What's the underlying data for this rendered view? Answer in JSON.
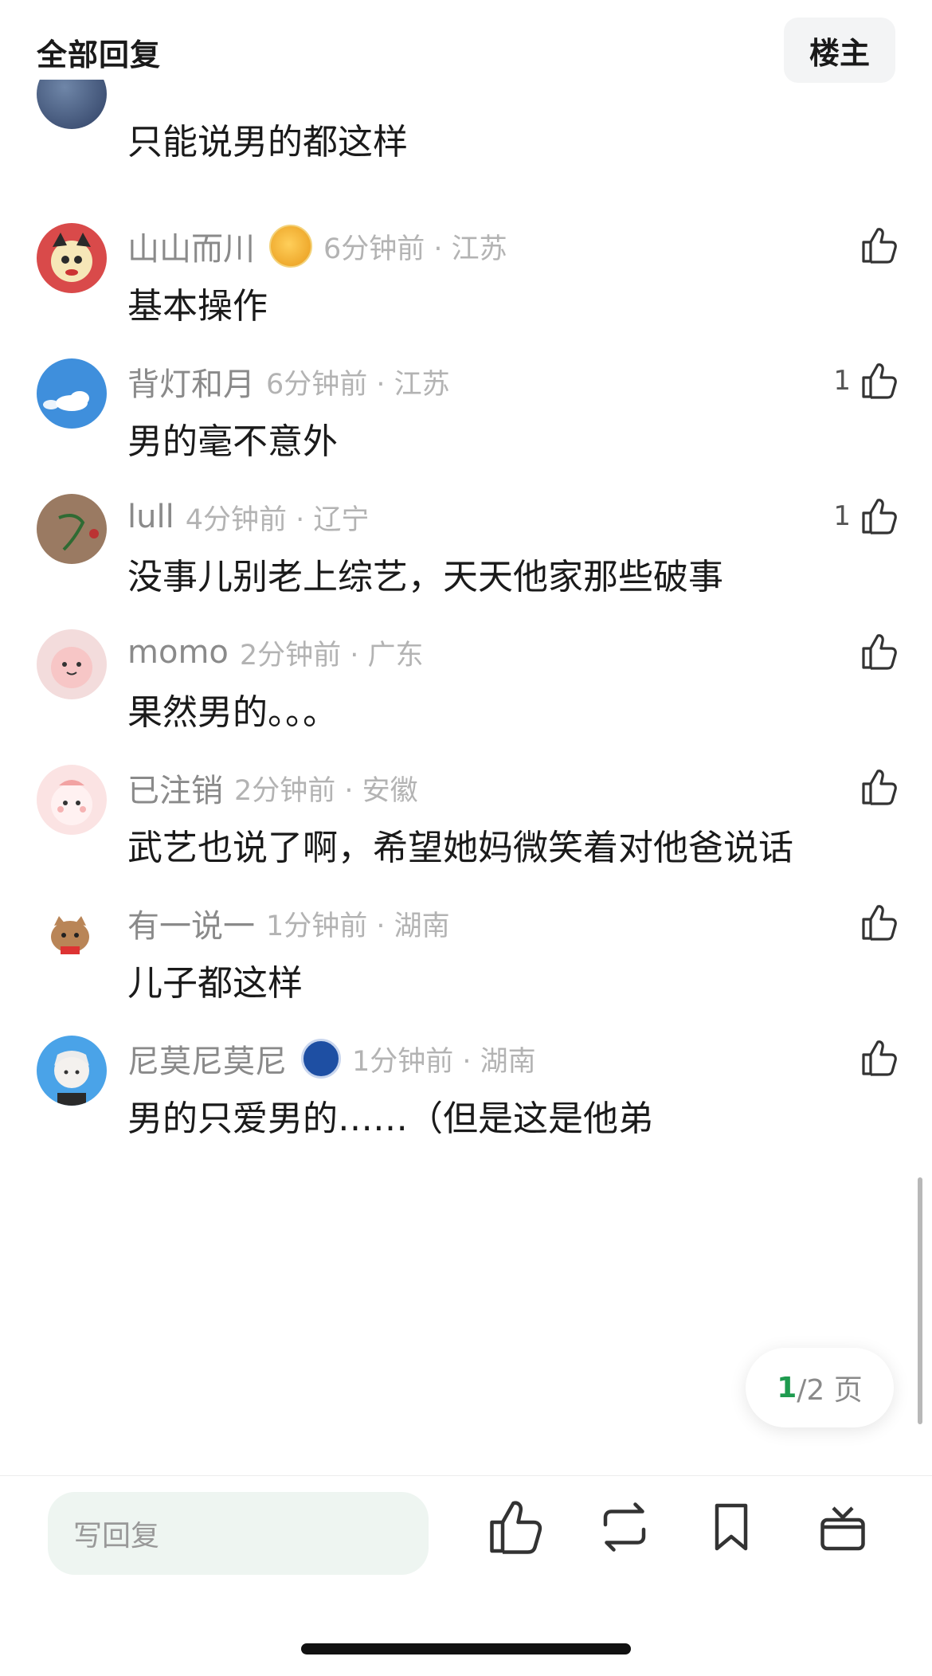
{
  "header": {
    "title": "全部回复",
    "owner_button": "楼主"
  },
  "partial_comment": {
    "text": "只能说男的都这样"
  },
  "comments": [
    {
      "user": "山山而川",
      "time": "6分钟前 · 江苏",
      "text": "基本操作",
      "likes": ""
    },
    {
      "user": "背灯和月",
      "time": "6分钟前 · 江苏",
      "text": "男的毫不意外",
      "likes": "1"
    },
    {
      "user": "lull",
      "time": "4分钟前 · 辽宁",
      "text": "没事儿别老上综艺，天天他家那些破事",
      "likes": "1"
    },
    {
      "user": "momo",
      "time": "2分钟前 · 广东",
      "text": "果然男的。。。",
      "likes": ""
    },
    {
      "user": "已注销",
      "time": "2分钟前 · 安徽",
      "text": "武艺也说了啊，希望她妈微笑着对他爸说话",
      "likes": ""
    },
    {
      "user": "有一说一",
      "time": "1分钟前 · 湖南",
      "text": "儿子都这样",
      "likes": ""
    },
    {
      "user": "尼莫尼莫尼",
      "time": "1分钟前 · 湖南",
      "text": "男的只爱男的……（但是这是他弟",
      "likes": ""
    }
  ],
  "pagination": {
    "current": "1",
    "rest": "/2 页"
  },
  "bottom_bar": {
    "reply_placeholder": "写回复",
    "icons": [
      "like-icon",
      "repost-icon",
      "bookmark-icon",
      "gift-icon"
    ]
  },
  "colors": {
    "accent": "#1e9b4f",
    "input_bg": "#eef5f1",
    "meta_gray": "#b3b3b3"
  }
}
